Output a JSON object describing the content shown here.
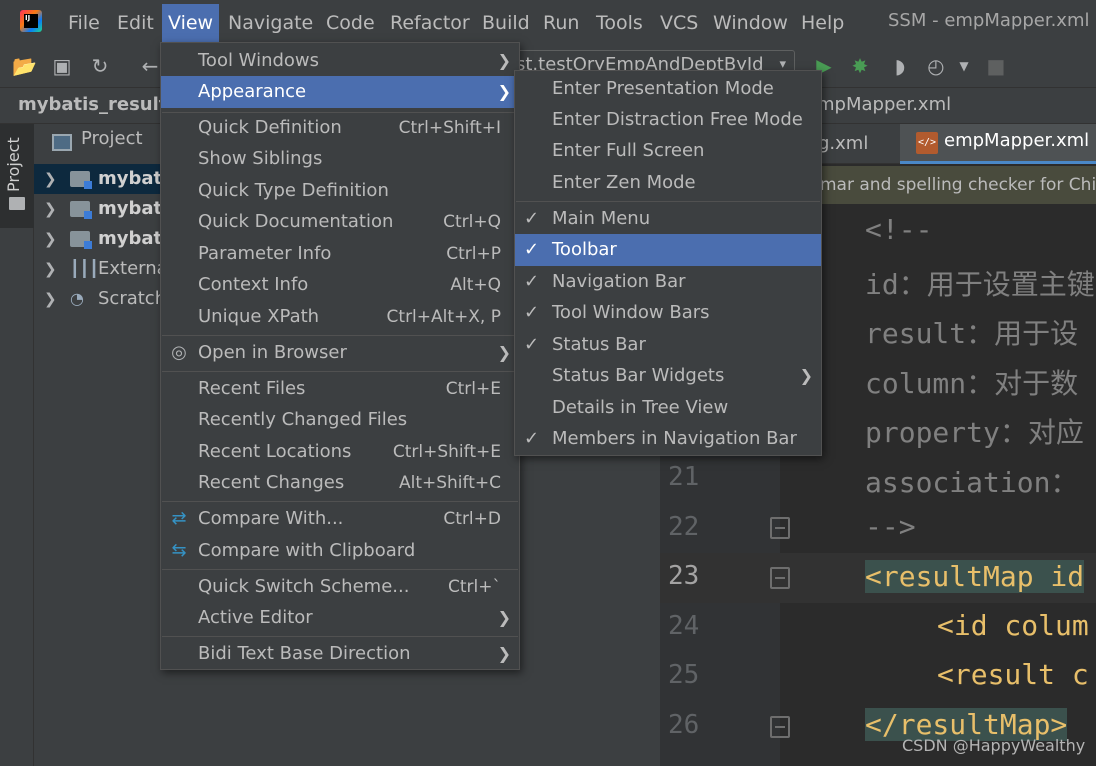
{
  "app": {
    "logo_text": "IJ",
    "window_title": "SSM - empMapper.xml"
  },
  "menubar": {
    "items": [
      {
        "label": "File"
      },
      {
        "label": "Edit"
      },
      {
        "label": "View"
      },
      {
        "label": "Navigate"
      },
      {
        "label": "Code"
      },
      {
        "label": "Refactor"
      },
      {
        "label": "Build"
      },
      {
        "label": "Run"
      },
      {
        "label": "Tools"
      },
      {
        "label": "VCS"
      },
      {
        "label": "Window"
      },
      {
        "label": "Help"
      }
    ],
    "active_item": "View"
  },
  "toolbar": {
    "run_config": "st.testQryEmpAndDeptById"
  },
  "navbar": {
    "project": "mybatis_resultM",
    "file": "mpMapper.xml"
  },
  "tool_stripe": {
    "project_label": "Project"
  },
  "project_panel": {
    "header": "Project",
    "tree": [
      {
        "label": "mybatis",
        "bold": true,
        "selected": true
      },
      {
        "label": "mybatis",
        "bold": true,
        "selected": false
      },
      {
        "label": "mybatis",
        "bold": true,
        "selected": false
      },
      {
        "label": "External",
        "bold": false,
        "selected": false
      },
      {
        "label": "Scratch",
        "bold": false,
        "selected": false
      }
    ]
  },
  "editor": {
    "inactive_tab": "g.xml",
    "active_tab": "empMapper.xml",
    "notice": "mar and spelling checker for Chin",
    "line_numbers": [
      "21",
      "22",
      "23",
      "24",
      "25",
      "26"
    ],
    "current_line": "23",
    "code_lines": [
      "<!--",
      "id：用于设置主键",
      "result：用于设",
      "column：对于数",
      "property：对应",
      "association：",
      "-->",
      "<resultMap id",
      "<id colum",
      "<result c",
      "</resultMap>"
    ]
  },
  "view_menu": {
    "items": [
      {
        "label": "Tool Windows",
        "shortcut": "",
        "submenu": true
      },
      {
        "label": "Appearance",
        "shortcut": "",
        "submenu": true,
        "active": true
      },
      {
        "label": "Quick Definition",
        "shortcut": "Ctrl+Shift+I"
      },
      {
        "label": "Show Siblings",
        "shortcut": ""
      },
      {
        "label": "Quick Type Definition",
        "shortcut": ""
      },
      {
        "label": "Quick Documentation",
        "shortcut": "Ctrl+Q"
      },
      {
        "label": "Parameter Info",
        "shortcut": "Ctrl+P"
      },
      {
        "label": "Context Info",
        "shortcut": "Alt+Q"
      },
      {
        "label": "Unique XPath",
        "shortcut": "Ctrl+Alt+X, P"
      },
      {
        "label": "Open in Browser",
        "shortcut": "",
        "submenu": true
      },
      {
        "label": "Recent Files",
        "shortcut": "Ctrl+E"
      },
      {
        "label": "Recently Changed Files",
        "shortcut": ""
      },
      {
        "label": "Recent Locations",
        "shortcut": "Ctrl+Shift+E"
      },
      {
        "label": "Recent Changes",
        "shortcut": "Alt+Shift+C"
      },
      {
        "label": "Compare With...",
        "shortcut": "Ctrl+D"
      },
      {
        "label": "Compare with Clipboard",
        "shortcut": ""
      },
      {
        "label": "Quick Switch Scheme...",
        "shortcut": "Ctrl+`"
      },
      {
        "label": "Active Editor",
        "shortcut": "",
        "submenu": true
      },
      {
        "label": "Bidi Text Base Direction",
        "shortcut": "",
        "submenu": true
      }
    ]
  },
  "appearance_menu": {
    "items": [
      {
        "label": "Enter Presentation Mode",
        "checked": false
      },
      {
        "label": "Enter Distraction Free Mode",
        "checked": false
      },
      {
        "label": "Enter Full Screen",
        "checked": false
      },
      {
        "label": "Enter Zen Mode",
        "checked": false
      },
      {
        "label": "Main Menu",
        "checked": true
      },
      {
        "label": "Toolbar",
        "checked": true,
        "active": true
      },
      {
        "label": "Navigation Bar",
        "checked": true
      },
      {
        "label": "Tool Window Bars",
        "checked": true
      },
      {
        "label": "Status Bar",
        "checked": true
      },
      {
        "label": "Status Bar Widgets",
        "checked": false,
        "submenu": true
      },
      {
        "label": "Details in Tree View",
        "checked": false
      },
      {
        "label": "Members in Navigation Bar",
        "checked": true
      }
    ]
  },
  "watermark": "CSDN @HappyWealthy",
  "colors": {
    "accent": "#4b6eaf",
    "background": "#2b2b2b",
    "panel": "#3c3f41",
    "tag": "#e8bf6a"
  }
}
